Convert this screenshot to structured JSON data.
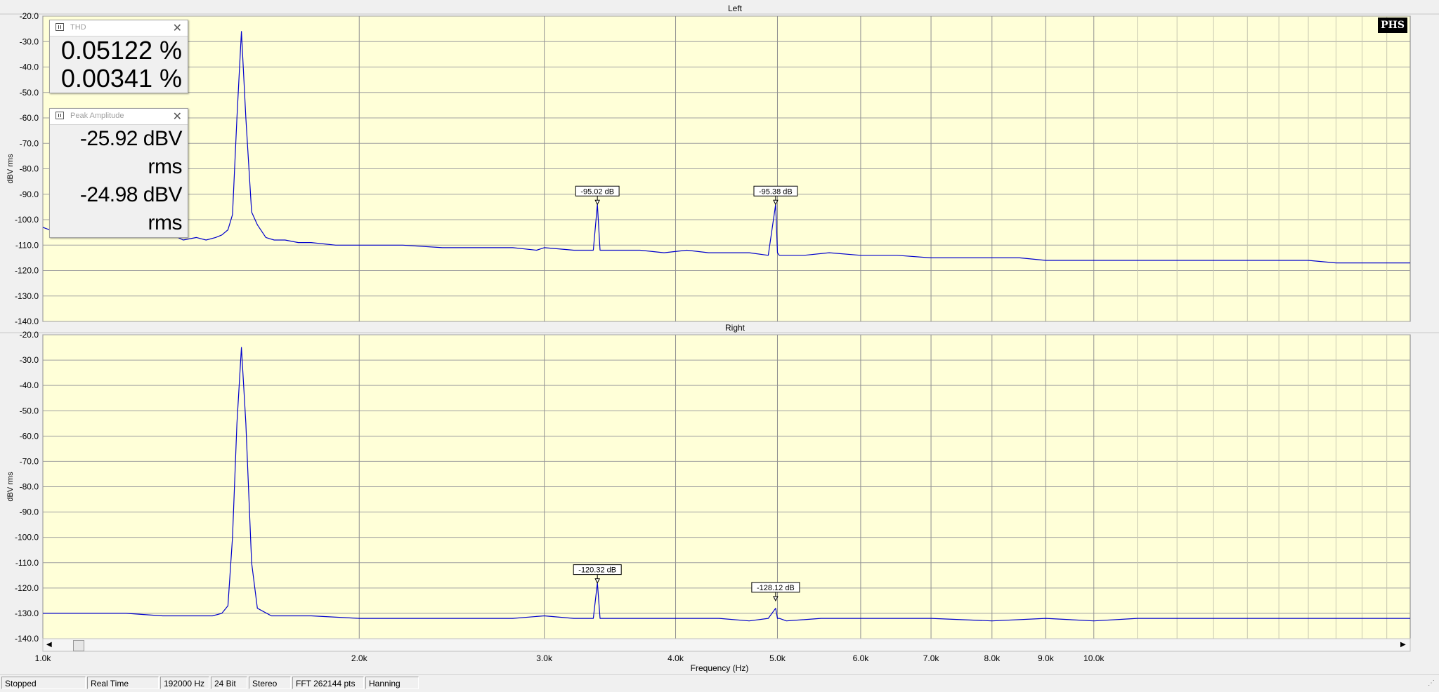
{
  "window": {
    "status": [
      "Stopped",
      "Real Time",
      "192000 Hz",
      "24 Bit",
      "Stereo",
      "FFT 262144 pts",
      "Hanning"
    ]
  },
  "logo": "PHS",
  "meters": {
    "thd": {
      "title": "THD",
      "values": [
        "0.05122 %",
        "0.00341 %"
      ]
    },
    "peak": {
      "title": "Peak Amplitude",
      "values": [
        "-25.92 dBV rms",
        "-24.98 dBV rms"
      ]
    }
  },
  "chart_data": {
    "type": "line",
    "xlabel": "Frequency (Hz)",
    "x_scale": "log",
    "xlim": [
      1000,
      20000
    ],
    "x_ticks": [
      {
        "value": 1000,
        "label": "1.0k"
      },
      {
        "value": 2000,
        "label": "2.0k"
      },
      {
        "value": 3000,
        "label": "3.0k"
      },
      {
        "value": 4000,
        "label": "4.0k"
      },
      {
        "value": 5000,
        "label": "5.0k"
      },
      {
        "value": 6000,
        "label": "6.0k"
      },
      {
        "value": 7000,
        "label": "7.0k"
      },
      {
        "value": 8000,
        "label": "8.0k"
      },
      {
        "value": 9000,
        "label": "9.0k"
      },
      {
        "value": 10000,
        "label": "10.0k"
      }
    ],
    "y_ticks": [
      {
        "value": -20,
        "label": "-20.0"
      },
      {
        "value": -30,
        "label": "-30.0"
      },
      {
        "value": -40,
        "label": "-40.0"
      },
      {
        "value": -50,
        "label": "-50.0"
      },
      {
        "value": -60,
        "label": "-60.0"
      },
      {
        "value": -70,
        "label": "-70.0"
      },
      {
        "value": -80,
        "label": "-80.0"
      },
      {
        "value": -90,
        "label": "-90.0"
      },
      {
        "value": -100,
        "label": "-100.0"
      },
      {
        "value": -110,
        "label": "-110.0"
      },
      {
        "value": -120,
        "label": "-120.0"
      },
      {
        "value": -130,
        "label": "-130.0"
      },
      {
        "value": -140,
        "label": "-140.0"
      }
    ],
    "grid": true,
    "line_color": "#0000cc",
    "background_color": "#ffffd8",
    "panels": [
      {
        "title": "Left",
        "ylabel": "dBV rms",
        "ylim": [
          -140,
          -20
        ],
        "series": [
          {
            "x": [
              1000,
              1030,
              1060,
              1100,
              1130,
              1180,
              1200,
              1260,
              1300,
              1330,
              1360,
              1400,
              1430,
              1460,
              1480,
              1500,
              1515,
              1530,
              1545,
              1560,
              1580,
              1600,
              1630,
              1660,
              1700,
              1750,
              1800,
              1900,
              2000,
              2200,
              2400,
              2600,
              2800,
              2950,
              3000,
              3200,
              3340,
              3370,
              3390,
              3500,
              3700,
              3900,
              4100,
              4300,
              4500,
              4700,
              4900,
              4980,
              5000,
              5020,
              5100,
              5300,
              5600,
              6000,
              6500,
              7000,
              7500,
              8000,
              8500,
              9000,
              9500,
              10000,
              11000,
              12000,
              13000,
              14000,
              15000,
              16000,
              17000,
              18000,
              19000,
              20000
            ],
            "y": [
              -103,
              -105,
              -104,
              -106,
              -105,
              -104,
              -107,
              -105,
              -103,
              -106,
              -108,
              -107,
              -108,
              -107,
              -106,
              -104,
              -98,
              -60,
              -26,
              -60,
              -97,
              -102,
              -107,
              -108,
              -108,
              -109,
              -109,
              -110,
              -110,
              -110,
              -111,
              -111,
              -111,
              -112,
              -111,
              -112,
              -112,
              -94,
              -112,
              -112,
              -112,
              -113,
              -112,
              -113,
              -113,
              -113,
              -114,
              -94,
              -113,
              -114,
              -114,
              -114,
              -113,
              -114,
              -114,
              -115,
              -115,
              -115,
              -115,
              -116,
              -116,
              -116,
              -116,
              -116,
              -116,
              -116,
              -116,
              -116,
              -117,
              -117,
              -117,
              -117
            ]
          }
        ],
        "annotations": [
          {
            "x": 3370,
            "y": -94,
            "label": "-95.02 dB"
          },
          {
            "x": 4980,
            "y": -94,
            "label": "-95.38 dB"
          }
        ]
      },
      {
        "title": "Right",
        "ylabel": "dBV rms",
        "ylim": [
          -140,
          -20
        ],
        "series": [
          {
            "x": [
              1000,
              1100,
              1200,
              1300,
              1400,
              1450,
              1480,
              1500,
              1515,
              1530,
              1545,
              1560,
              1580,
              1600,
              1650,
              1700,
              1800,
              2000,
              2200,
              2500,
              2800,
              3000,
              3200,
              3340,
              3370,
              3390,
              3500,
              3800,
              4100,
              4400,
              4700,
              4900,
              4980,
              5000,
              5020,
              5100,
              5500,
              6000,
              7000,
              8000,
              9000,
              10000,
              11000,
              12000,
              13000,
              14000,
              15000,
              16000,
              17000,
              18000,
              19000,
              20000
            ],
            "y": [
              -130,
              -130,
              -130,
              -131,
              -131,
              -131,
              -130,
              -127,
              -100,
              -55,
              -25,
              -55,
              -110,
              -128,
              -131,
              -131,
              -131,
              -132,
              -132,
              -132,
              -132,
              -131,
              -132,
              -132,
              -118,
              -132,
              -132,
              -132,
              -132,
              -132,
              -133,
              -132,
              -128,
              -132,
              -132,
              -133,
              -132,
              -132,
              -132,
              -133,
              -132,
              -133,
              -132,
              -132,
              -132,
              -132,
              -132,
              -132,
              -132,
              -132,
              -132,
              -132
            ]
          }
        ],
        "annotations": [
          {
            "x": 3370,
            "y": -118,
            "label": "-120.32 dB"
          },
          {
            "x": 4980,
            "y": -125,
            "label": "-128.12 dB"
          }
        ]
      }
    ]
  }
}
